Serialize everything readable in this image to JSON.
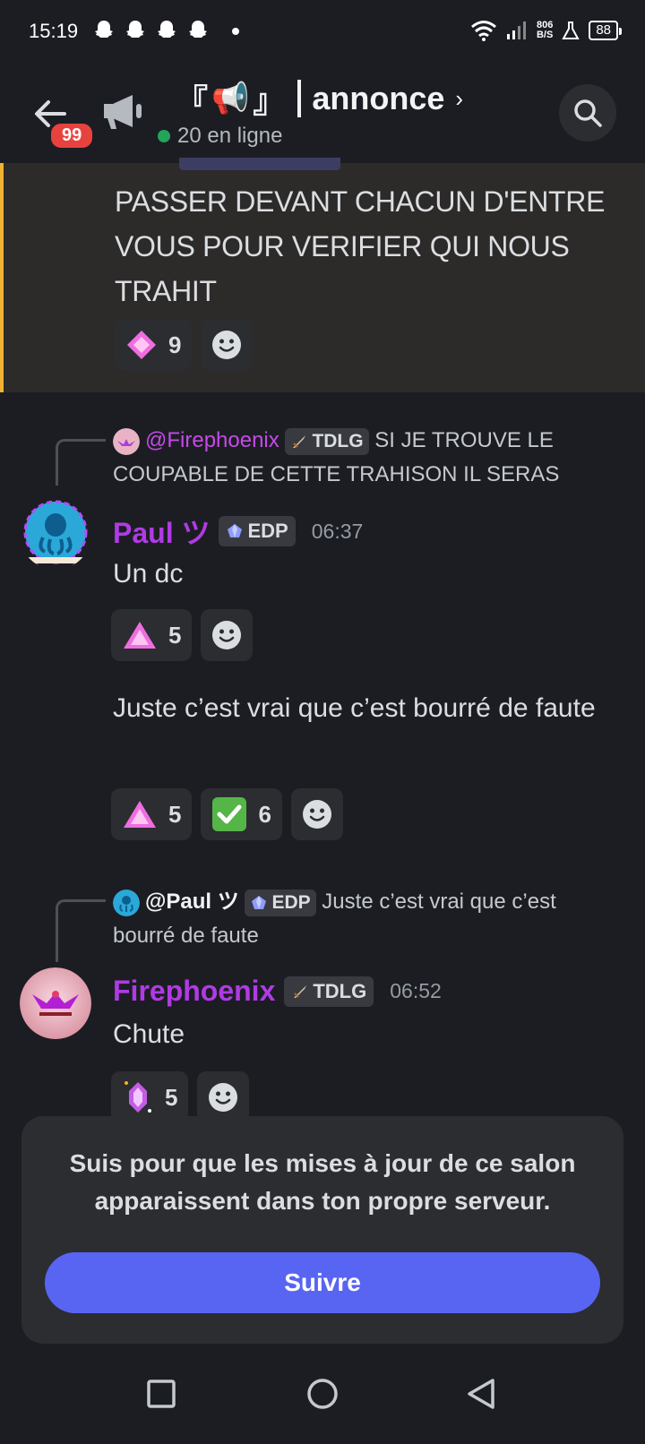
{
  "status_bar": {
    "time": "15:19",
    "net_speed_value": "806",
    "net_speed_unit": "B/S",
    "battery": "88"
  },
  "header": {
    "badge_count": "99",
    "channel_emoji_left": "『",
    "channel_emoji": "📢",
    "channel_emoji_right": "』",
    "channel_name": "annonce",
    "chevron": "›",
    "online_text": "20 en ligne"
  },
  "highlight_message": {
    "text": "PASSER DEVANT CHACUN D'ENTRE VOUS POUR VERIFIER  QUI NOUS TRAHIT",
    "reactions": [
      {
        "icon": "pink-diamond-icon",
        "count": "9"
      }
    ]
  },
  "messages": [
    {
      "reply_to": {
        "mention": "@Firephoenix",
        "tag": "TDLG",
        "text": "SI JE TROUVE LE COUPABLE DE CETTE TRAHISON IL SERAS"
      },
      "author": "Paul ツ",
      "tag": "EDP",
      "time": "06:37",
      "content": [
        {
          "text": "Un dc",
          "reactions": [
            {
              "icon": "pink-triangle-icon",
              "count": "5"
            }
          ]
        },
        {
          "text": "Juste c’est vrai que c’est bourré de faute",
          "reactions": [
            {
              "icon": "pink-triangle-icon",
              "count": "5"
            },
            {
              "icon": "green-check-icon",
              "count": "6"
            }
          ]
        }
      ]
    },
    {
      "reply_to": {
        "mention": "@Paul ツ",
        "tag": "EDP",
        "text": "Juste c’est vrai que c’est bourré de faute"
      },
      "author": "Firephoenix",
      "tag": "TDLG",
      "time": "06:52",
      "content": [
        {
          "text": "Chute",
          "reactions": [
            {
              "icon": "purple-crystal-icon",
              "count": "5"
            }
          ]
        }
      ]
    }
  ],
  "follow_card": {
    "text": "Suis pour que les mises à jour de ce salon apparaissent dans ton propre serveur.",
    "button_label": "Suivre"
  },
  "colors": {
    "background": "#1c1d23",
    "accent": "#5865f2",
    "username": "#b03be4",
    "highlight_border": "#f0b232"
  }
}
